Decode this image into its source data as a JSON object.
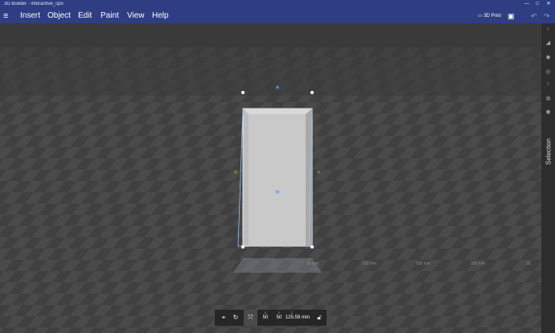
{
  "window": {
    "title": "3D Builder - interactive_cpo",
    "min": "—",
    "max": "□",
    "close": "✕"
  },
  "menu": {
    "items": [
      "Insert",
      "Object",
      "Edit",
      "Paint",
      "View",
      "Help"
    ],
    "print_label": "3D Print"
  },
  "sidebar": {
    "selection_label": "Selection"
  },
  "toolbar": {
    "x_label": "X",
    "y_label": "Y",
    "z_label": "Z",
    "x": "50",
    "y": "50",
    "z": "125.59",
    "unit": "mm"
  },
  "rulers": [
    "50 mm",
    "100 mm",
    "150 mm",
    "200 mm",
    "25"
  ],
  "colors": {
    "titlebar": "#2f3d82",
    "accent_green": "#7ed321",
    "accent_blue": "#4aa3ff"
  }
}
